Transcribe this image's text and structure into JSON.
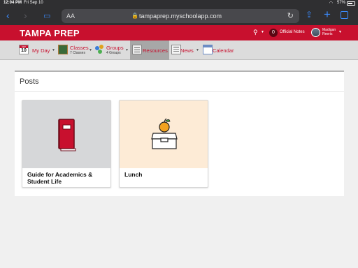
{
  "status_bar": {
    "time": "12:04 PM",
    "date": "Fri Sep 10",
    "battery": "57%"
  },
  "browser": {
    "text_size_label": "AA",
    "url": "tampaprep.myschoolapp.com"
  },
  "header": {
    "brand": "TAMPA PREP",
    "official_notes_count": "0",
    "official_notes_label": "Official Notes",
    "user_name": "Madigan Reeris"
  },
  "nav": {
    "my_day": {
      "label": "My Day",
      "calendar_month": "SEP",
      "calendar_day": "10"
    },
    "classes": {
      "label": "Classes",
      "sub": "7 Classes"
    },
    "groups": {
      "label": "Groups",
      "sub": "4 Groups"
    },
    "resources": {
      "label": "Resources"
    },
    "news": {
      "label": "News"
    },
    "calendar": {
      "label": "Calendar"
    }
  },
  "posts": {
    "heading": "Posts",
    "items": [
      {
        "title": "Guide for Academics & Student Life",
        "icon": "book-icon"
      },
      {
        "title": "Lunch",
        "icon": "lunchbox-apple-icon"
      }
    ]
  },
  "colors": {
    "brand_red": "#c8102e",
    "lunch_card_bg": "#fdebd6",
    "guide_card_bg": "#d6d7d9"
  }
}
